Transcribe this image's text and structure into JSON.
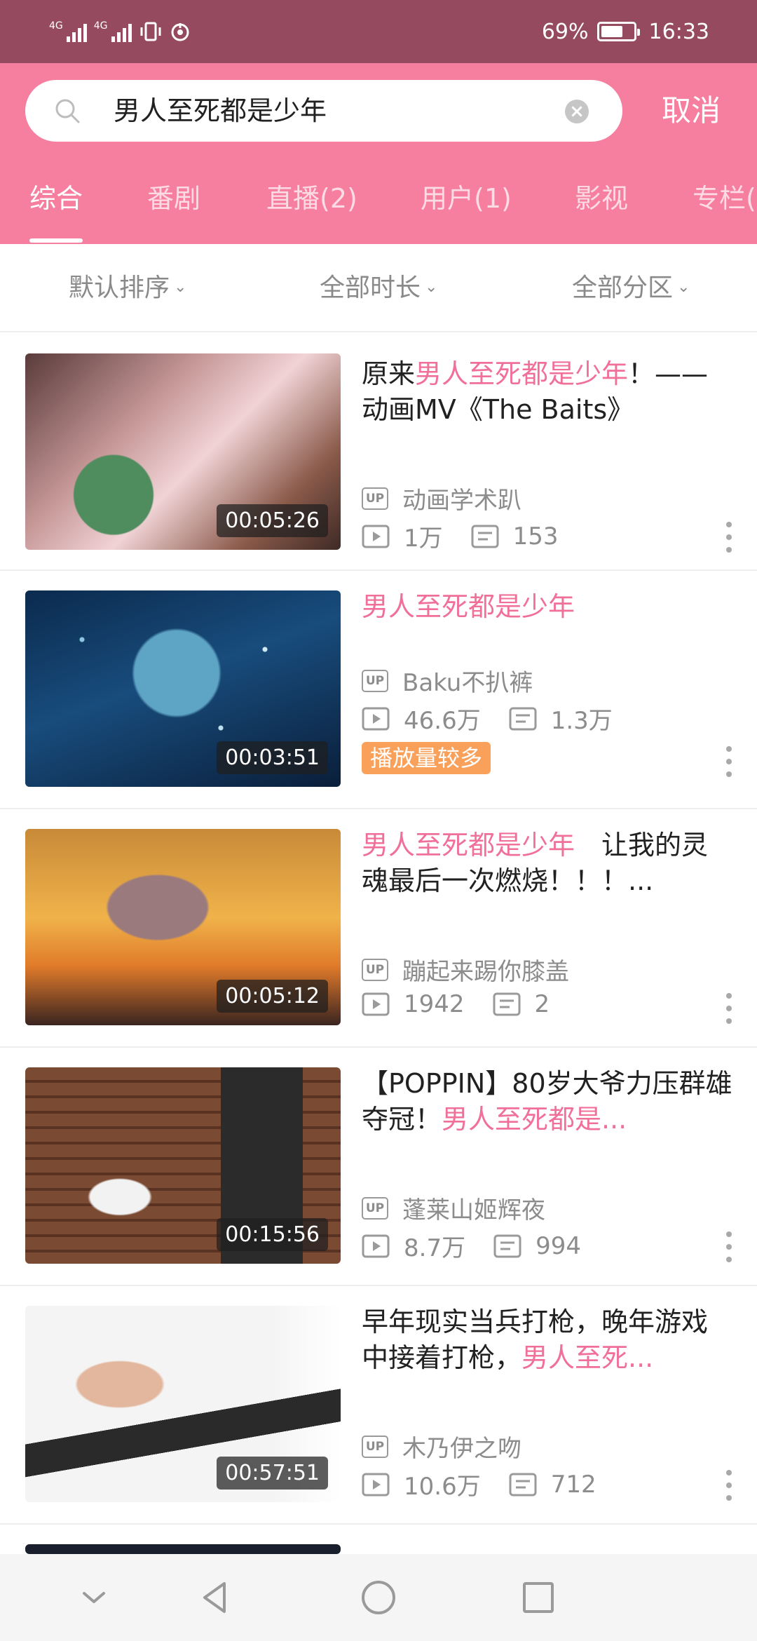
{
  "status_bar": {
    "network_1": "4G",
    "network_2": "4G",
    "battery_percent": "69%",
    "battery_level": 0.69,
    "time": "16:33",
    "icons": [
      "signal-icon",
      "signal-icon",
      "vibrate-icon",
      "nfc-icon",
      "battery-icon"
    ]
  },
  "search": {
    "query": "男人至死都是少年",
    "cancel_label": "取消"
  },
  "tabs": [
    {
      "label": "综合",
      "active": true
    },
    {
      "label": "番剧",
      "active": false
    },
    {
      "label": "直播(2)",
      "active": false
    },
    {
      "label": "用户(1)",
      "active": false
    },
    {
      "label": "影视",
      "active": false
    },
    {
      "label": "专栏(",
      "active": false
    }
  ],
  "filters": [
    {
      "label": "默认排序"
    },
    {
      "label": "全部时长"
    },
    {
      "label": "全部分区"
    }
  ],
  "videos": [
    {
      "title_pre": "原来",
      "title_hl": "男人至死都是少年",
      "title_post": "！——动画MV《The Baits》",
      "duration": "00:05:26",
      "uploader": "动画学术趴",
      "views": "1万",
      "danmaku": "153"
    },
    {
      "title_pre": "",
      "title_hl": "男人至死都是少年",
      "title_post": "",
      "duration": "00:03:51",
      "uploader": "Baku不扒裤",
      "views": "46.6万",
      "danmaku": "1.3万",
      "badge": "播放量较多"
    },
    {
      "title_pre": "",
      "title_hl": "男人至死都是少年",
      "title_post": "　让我的灵魂最后一次燃烧！！！...",
      "duration": "00:05:12",
      "uploader": "蹦起来踢你膝盖",
      "views": "1942",
      "danmaku": "2"
    },
    {
      "title_pre": "【POPPIN】80岁大爷力压群雄夺冠！",
      "title_hl": "男人至死都是...",
      "title_post": "",
      "duration": "00:15:56",
      "uploader": "蓬莱山姬辉夜",
      "views": "8.7万",
      "danmaku": "994"
    },
    {
      "title_pre": "早年现实当兵打枪，晚年游戏中接着打枪，",
      "title_hl": "男人至死...",
      "title_post": "",
      "duration": "00:57:51",
      "uploader": "木乃伊之吻",
      "views": "10.6万",
      "danmaku": "712"
    }
  ],
  "up_label": "UP",
  "colors": {
    "status_bar": "#954a5f",
    "header": "#f67f9f",
    "highlight": "#f0709a",
    "hot_badge": "#f9a15a"
  }
}
